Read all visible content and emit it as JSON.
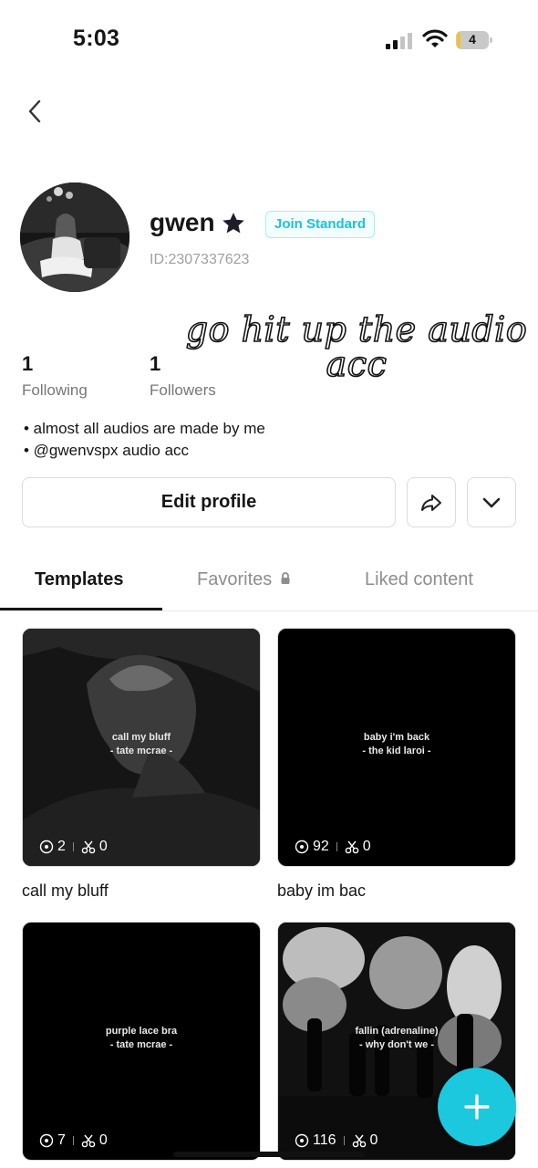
{
  "status_bar": {
    "time": "5:03",
    "battery": "4"
  },
  "profile": {
    "username": "gwen",
    "membership_badge": "Join Standard",
    "id": "ID:2307337623",
    "overlay_text": "go hit up the audio acc",
    "stats": [
      {
        "value": "1",
        "label": "Following"
      },
      {
        "value": "1",
        "label": "Followers"
      }
    ],
    "bio": [
      "• almost all audios are made by me",
      "• @gwenvspx audio acc"
    ],
    "edit_label": "Edit profile"
  },
  "tabs": [
    {
      "label": "Templates",
      "active": true
    },
    {
      "label": "Favorites",
      "locked": true
    },
    {
      "label": "Liked content"
    }
  ],
  "templates": [
    {
      "title": "call my bluff",
      "caption_line1": "call my bluff",
      "caption_line2": "- tate mcrae -",
      "views": "2",
      "uses": "0"
    },
    {
      "title": "baby im bac",
      "caption_line1": "baby i'm back",
      "caption_line2": "- the kid laroi -",
      "views": "92",
      "uses": "0"
    },
    {
      "title": "",
      "caption_line1": "purple lace bra",
      "caption_line2": "- tate mcrae -",
      "views": "7",
      "uses": "0"
    },
    {
      "title": "",
      "caption_line1": "fallin (adrenaline)",
      "caption_line2": "- why don't we -",
      "views": "116",
      "uses": "0"
    }
  ],
  "colors": {
    "accent": "#1cc8de",
    "badge_text": "#1cc3d6"
  }
}
